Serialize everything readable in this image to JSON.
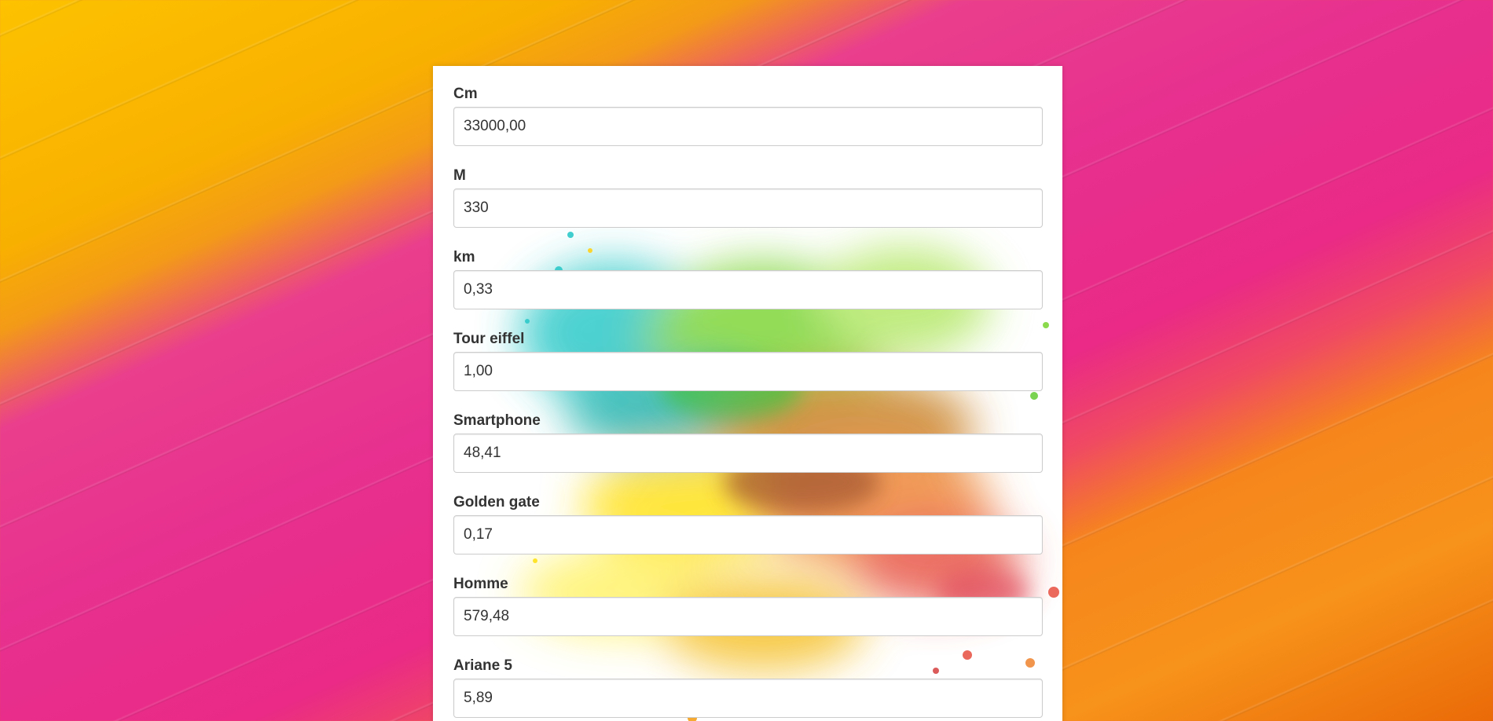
{
  "colors": {
    "background_yellow": "#fdc200",
    "background_pink": "#e7308f",
    "background_orange": "#f7921a",
    "card_background": "#ffffff",
    "label_text": "#333333",
    "input_border": "#cccccc"
  },
  "converter": {
    "fields": [
      {
        "label": "Cm",
        "value": "33000,00"
      },
      {
        "label": "M",
        "value": "330"
      },
      {
        "label": "km",
        "value": "0,33"
      },
      {
        "label": "Tour eiffel",
        "value": "1,00"
      },
      {
        "label": "Smartphone",
        "value": "48,41"
      },
      {
        "label": "Golden gate",
        "value": "0,17"
      },
      {
        "label": "Homme",
        "value": "579,48"
      },
      {
        "label": "Ariane 5",
        "value": "5,89"
      }
    ]
  }
}
